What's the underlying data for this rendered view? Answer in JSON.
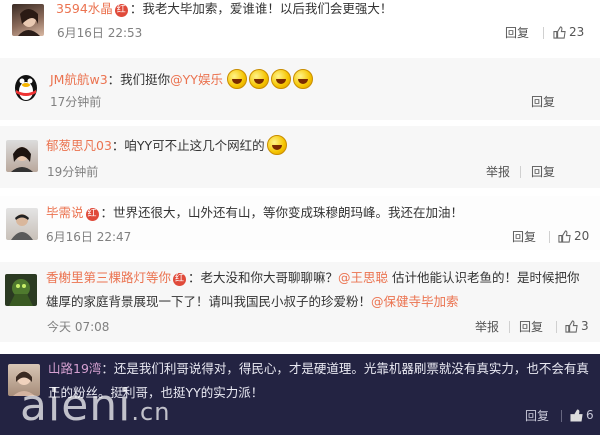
{
  "comments": [
    {
      "user": "3594水晶",
      "badge": "红",
      "text_before": "：我老大毕加索，爱谁谁！以后我们会更强大！",
      "time": "6月16日 22:53",
      "reply": "回复",
      "likes": "23"
    },
    {
      "user": "JM航航w3",
      "text_before": "：我们挺你",
      "mention": "@YY娱乐",
      "time": "17分钟前",
      "reply": "回复"
    },
    {
      "user": "郁葱思凡03",
      "text_before": "：咱YY可不止这几个网红的",
      "time": "19分钟前",
      "report": "举报",
      "reply": "回复"
    },
    {
      "user": "毕需说",
      "badge": "红",
      "text_before": "：世界还很大，山外还有山，等你变成珠穆朗玛峰。我还在加油！",
      "time": "6月16日 22:47",
      "reply": "回复",
      "likes": "20"
    },
    {
      "user": "香榭里第三棵路灯等你",
      "badge": "红",
      "text_before": "：老大没和你大哥聊聊嘛？",
      "mention": "@王思聪",
      "text_after": " 估计他能认识老鱼的！是时候把你",
      "line2_before": "雄厚的家庭背景展现一下了！请叫我国民小叔子的珍爱粉！",
      "line2_mention": "@保健寺毕加索",
      "time": "今天 07:08",
      "report": "举报",
      "reply": "回复",
      "likes": "3"
    },
    {
      "user": "山路19湾",
      "text_before": "：还是我们利哥说得对，得民心，才是硬道理。光靠机器刷票就没有真实力，也不会有真",
      "line2_before": "正的粉丝。挺利哥，也挺YY的实力派！",
      "reply": "回复",
      "likes": "6"
    }
  ],
  "watermark": "aieni",
  "watermark_suffix": ".cn"
}
